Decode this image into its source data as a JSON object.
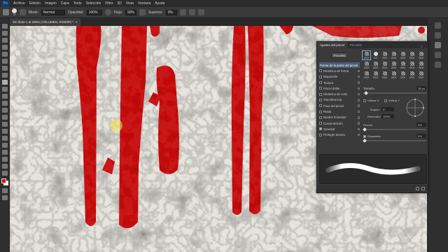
{
  "menubar": {
    "logo": "Ps",
    "items": [
      "Archivo",
      "Edición",
      "Imagen",
      "Capa",
      "Texto",
      "Selección",
      "Filtro",
      "3D",
      "Vista",
      "Ventana",
      "Ayuda"
    ]
  },
  "options": {
    "mode_label": "Modo:",
    "mode_value": "Normal",
    "opacity_label": "Opacidad:",
    "opacity_value": "100%",
    "flow_label": "Flujo:",
    "flow_value": "90%",
    "smooth_label": "Suavizar:",
    "smooth_value": "0%",
    "size_value": "19"
  },
  "document": {
    "tab_title": "Sin título-1 al 200% (VOLUMEN, RGB/8#) *",
    "close": "×"
  },
  "colors": {
    "foreground": "#d81010",
    "background": "#ffffff",
    "blood": "#c80d0d",
    "wall": "#e8e6e0"
  },
  "brush_panel": {
    "tabs": [
      "Ajustes del pincel",
      "Pinceles"
    ],
    "presets_button": "Pinceles",
    "options": [
      {
        "label": "Forma de la punta del pincel",
        "checked": null,
        "head": true
      },
      {
        "label": "Dinámica de forma",
        "checked": false
      },
      {
        "label": "Dispersión",
        "checked": false
      },
      {
        "label": "Textura",
        "checked": false
      },
      {
        "label": "Pincel doble",
        "checked": false
      },
      {
        "label": "Dinámica de color",
        "checked": false
      },
      {
        "label": "Transferencia",
        "checked": false
      },
      {
        "label": "Pose del pincel",
        "checked": false
      },
      {
        "label": "Ruido",
        "checked": false
      },
      {
        "label": "Bordes húmedos",
        "checked": false
      },
      {
        "label": "Concentración",
        "checked": false
      },
      {
        "label": "Suavizar",
        "checked": true
      },
      {
        "label": "Proteger textura",
        "checked": false
      }
    ],
    "brush_tips": [
      {
        "size": "2500",
        "kind": "tex"
      },
      {
        "size": "123",
        "kind": "hard"
      },
      {
        "size": "2500",
        "kind": "tex"
      },
      {
        "size": "2500",
        "kind": "tex"
      },
      {
        "size": "2500",
        "kind": "tex"
      },
      {
        "size": "2500",
        "kind": "tex"
      },
      {
        "size": "2500",
        "kind": "tex"
      },
      {
        "size": "2500",
        "kind": "tex"
      },
      {
        "size": "2500",
        "kind": "tex"
      },
      {
        "size": "2500",
        "kind": "tex"
      },
      {
        "size": "2500",
        "kind": "tex"
      },
      {
        "size": "2500",
        "kind": "tex"
      },
      {
        "size": "2500",
        "kind": "tex"
      },
      {
        "size": "2500",
        "kind": "tex"
      },
      {
        "size": "2500",
        "kind": "tex"
      },
      {
        "size": "2500",
        "kind": "tex"
      },
      {
        "size": "2500",
        "kind": "tex"
      },
      {
        "size": "2500",
        "kind": "tex"
      },
      {
        "size": "2500",
        "kind": "tex"
      },
      {
        "size": "2500",
        "kind": "tex"
      },
      {
        "size": "2500",
        "kind": "tex"
      }
    ],
    "size_label": "Tamaño",
    "size_value": "35 px",
    "flip_x": "Voltear X",
    "flip_y": "Voltear Y",
    "angle_label": "Ángulo:",
    "angle_value": "0°",
    "roundness_label": "Redondez:",
    "roundness_value": "100%",
    "hardness_label": "Dureza",
    "hardness_value": "0%",
    "spacing_label": "Espaciado",
    "spacing_value": "0%",
    "spacing_checked": true
  }
}
